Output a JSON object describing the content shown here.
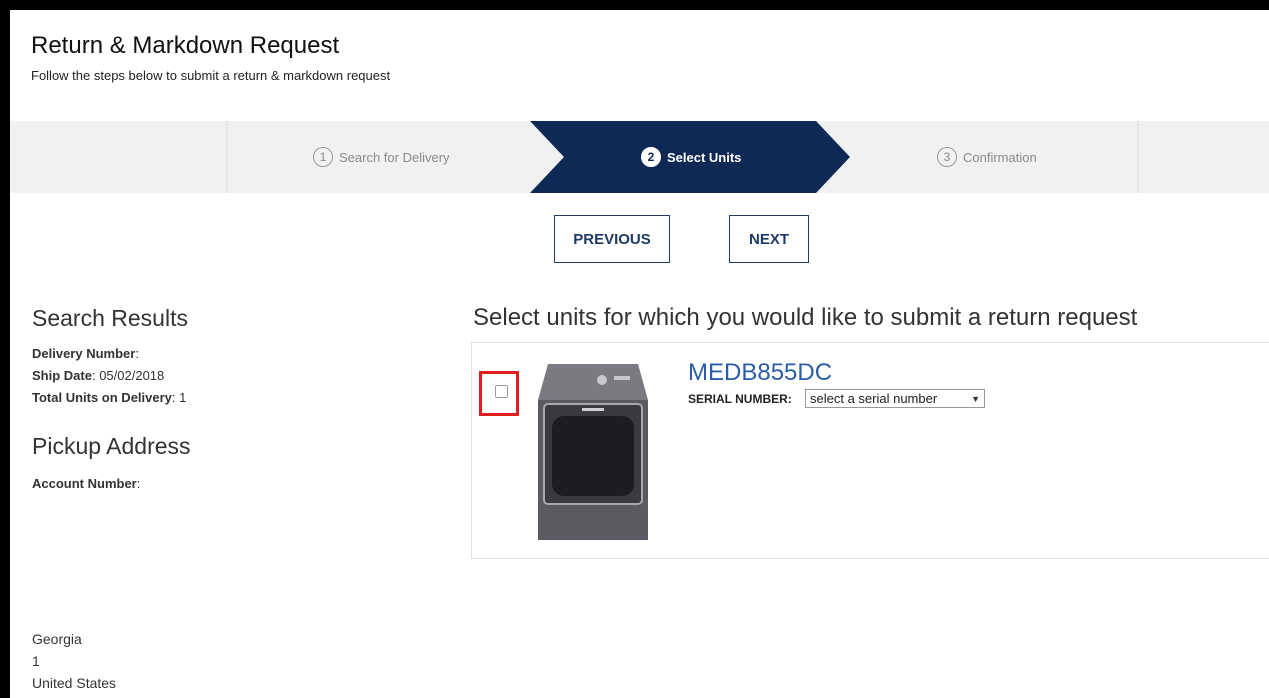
{
  "header": {
    "title": "Return & Markdown Request",
    "subtitle": "Follow the steps below to submit a return & markdown request"
  },
  "steps": [
    {
      "num": "1",
      "label": "Search for Delivery"
    },
    {
      "num": "2",
      "label": "Select Units"
    },
    {
      "num": "3",
      "label": "Confirmation"
    }
  ],
  "nav": {
    "previous": "PREVIOUS",
    "next": "NEXT"
  },
  "search_results": {
    "heading": "Search Results",
    "delivery_number_label": "Delivery Number",
    "delivery_number_value": ":",
    "ship_date_label": "Ship Date",
    "ship_date_value": ": 05/02/2018",
    "total_units_label": "Total Units on Delivery",
    "total_units_value": ": 1"
  },
  "pickup": {
    "heading": "Pickup Address",
    "account_label": "Account Number",
    "account_value": ":",
    "address_lines": [
      "Georgia",
      "1",
      "United States"
    ]
  },
  "units": {
    "heading": "Select units for which you would like to submit a return request",
    "model": "MEDB855DC",
    "serial_label": "SERIAL NUMBER:",
    "serial_select_value": "select a serial number"
  },
  "colors": {
    "step_active_bg": "#0e2a54",
    "button_border": "#1f3a66",
    "model_link": "#2b5da8",
    "highlight": "#e02020"
  }
}
